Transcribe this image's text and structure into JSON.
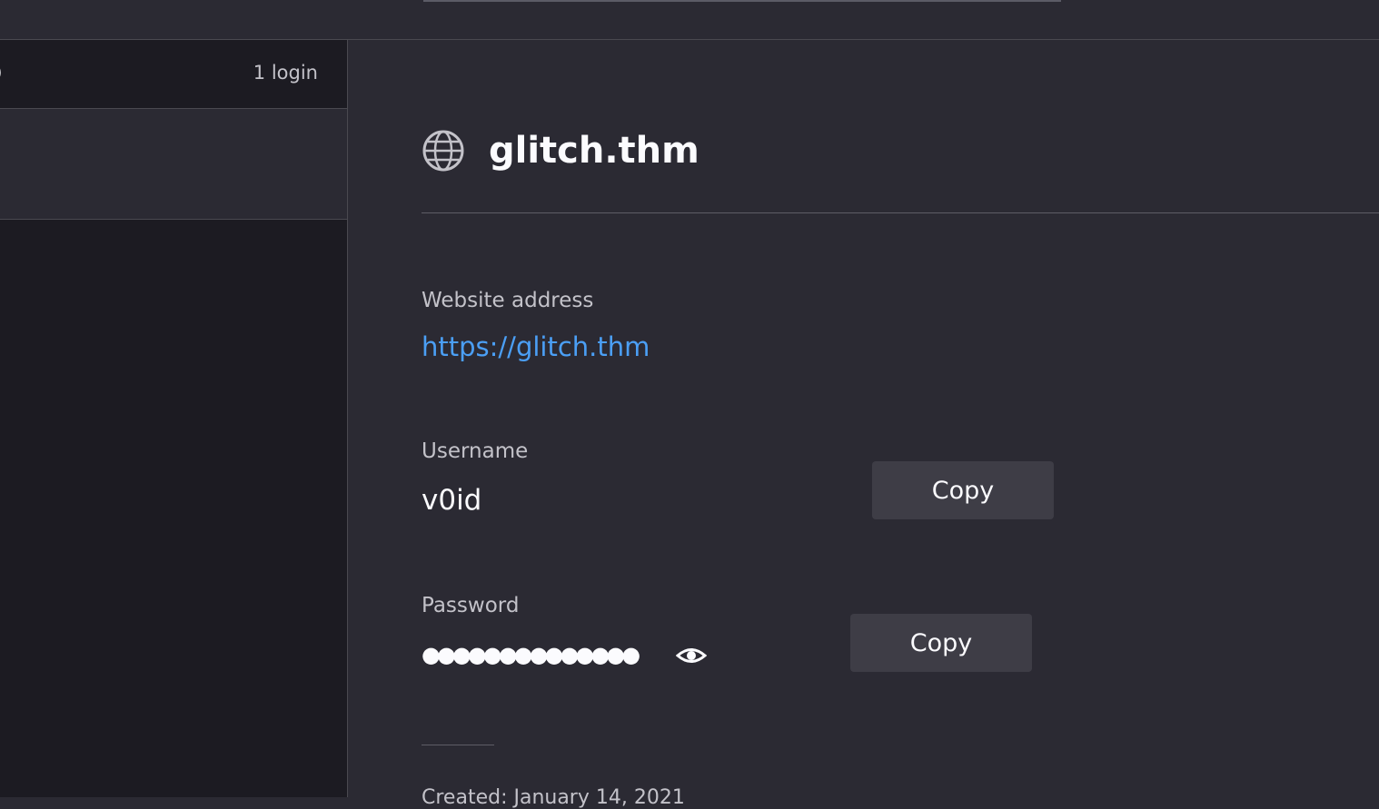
{
  "list": {
    "sort_fragment": ")",
    "login_count": "1 login"
  },
  "details": {
    "title": "glitch.thm",
    "title_icon": "globe-icon",
    "website_label": "Website address",
    "website_url": "https://glitch.thm",
    "username_label": "Username",
    "username": "v0id",
    "password_label": "Password",
    "password_masked": "●●●●●●●●●●●●●●",
    "reveal_icon": "eye-icon",
    "copy_label": "Copy",
    "created": "Created: January 14, 2021"
  },
  "colors": {
    "background": "#2b2a33",
    "sidebar": "#1c1b22",
    "link": "#4b9ff5",
    "button": "#3e3d46"
  }
}
